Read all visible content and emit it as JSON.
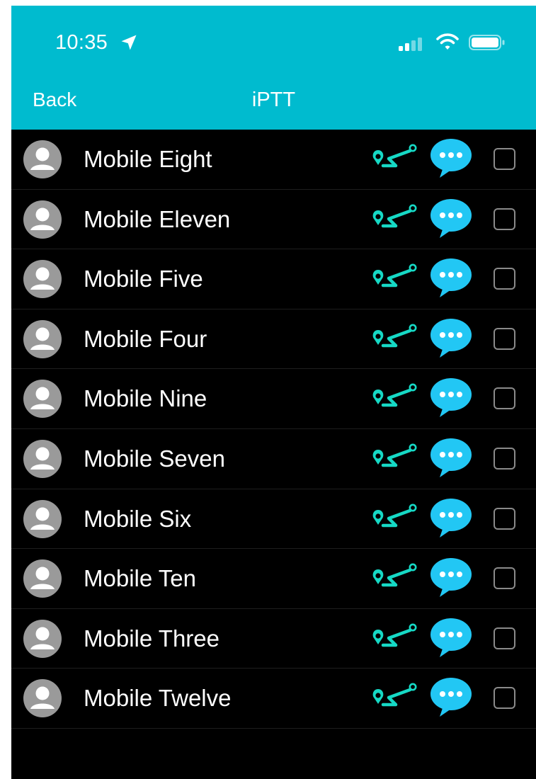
{
  "status_bar": {
    "time": "10:35",
    "icons": [
      "location-arrow-icon",
      "cellular-signal-icon",
      "wifi-icon",
      "battery-icon"
    ]
  },
  "nav": {
    "back_label": "Back",
    "title": "iPTT"
  },
  "colors": {
    "header": "#00bbcf",
    "background": "#000000",
    "accent_map": "#16d9c5",
    "accent_chat": "#22c7f4",
    "avatar": "#9a9a9a",
    "checkbox_border": "#8a8a8a"
  },
  "contacts": [
    {
      "name": "Mobile Eight",
      "checked": false
    },
    {
      "name": "Mobile Eleven",
      "checked": false
    },
    {
      "name": "Mobile Five",
      "checked": false
    },
    {
      "name": "Mobile Four",
      "checked": false
    },
    {
      "name": "Mobile Nine",
      "checked": false
    },
    {
      "name": "Mobile Seven",
      "checked": false
    },
    {
      "name": "Mobile Six",
      "checked": false
    },
    {
      "name": "Mobile Ten",
      "checked": false
    },
    {
      "name": "Mobile Three",
      "checked": false
    },
    {
      "name": "Mobile Twelve",
      "checked": false
    }
  ],
  "row_icons": [
    "user-avatar-icon",
    "map-route-icon",
    "chat-bubble-icon",
    "checkbox"
  ]
}
